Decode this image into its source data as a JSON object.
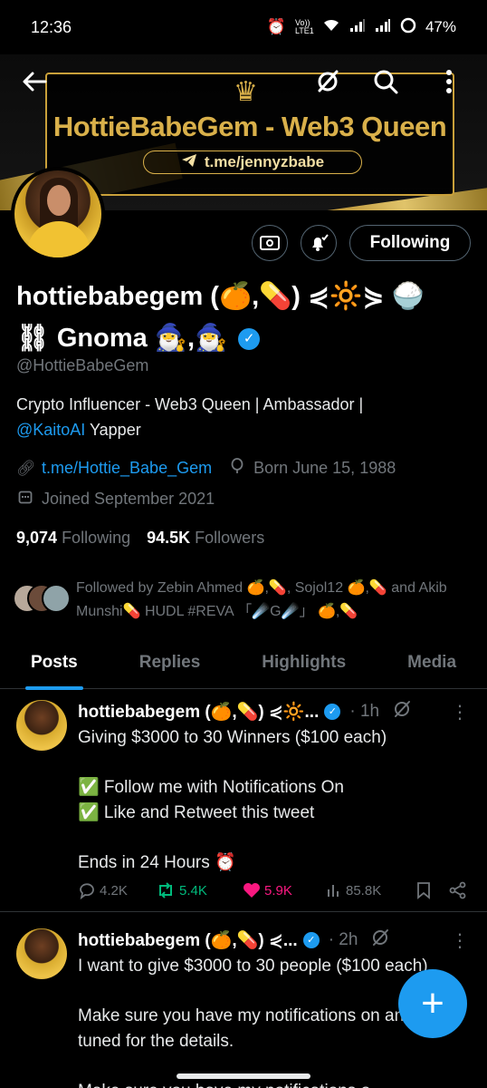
{
  "status_bar": {
    "time": "12:36",
    "network": "Vo)) LTE1",
    "battery": "47%"
  },
  "banner": {
    "title": "HottieBabeGem - Web3 Queen",
    "telegram": "t.me/jennyzbabe"
  },
  "header": {
    "back_icon": "arrow-left",
    "grok_icon": "slashed-circle",
    "search_icon": "search",
    "more_icon": "more-vertical"
  },
  "actions": {
    "following_label": "Following"
  },
  "profile": {
    "name_line1": "hottiebabegem (🍊,💊) ⋞🔆⋟ 🍚",
    "name_line2": "⛓ Gnoma 🧙‍♂️,🧙‍♂️",
    "handle": "@HottieBabeGem",
    "bio_text": "Crypto Influencer - Web3 Queen | Ambassador |",
    "bio_mention": "@KaitoAI",
    "bio_suffix": " Yapper",
    "link": "t.me/Hottie_Babe_Gem",
    "born": "Born June 15, 1988",
    "joined": "Joined September 2021",
    "following_count": "9,074",
    "following_label": "Following",
    "followers_count": "94.5K",
    "followers_label": "Followers",
    "followed_by": "Followed by Zebin Ahmed 🍊,💊, Sojol12 🍊,💊 and Akib Munshi💊 HUDL #REVA 「☄️G☄️」 🍊,💊"
  },
  "tabs": [
    "Posts",
    "Replies",
    "Highlights",
    "Media"
  ],
  "tweets": [
    {
      "name": "hottiebabegem (🍊,💊) ⋞🔆...",
      "time": "· 1h",
      "text": "Giving $3000 to 30 Winners ($100 each)\n\n✅ Follow me with Notifications On\n✅ Like and Retweet this tweet\n\nEnds in 24 Hours ⏰",
      "replies": "4.2K",
      "retweets": "5.4K",
      "likes": "5.9K",
      "views": "85.8K"
    },
    {
      "name": "hottiebabegem (🍊,💊) ⋞...",
      "time": "· 2h",
      "text": "I want to give $3000 to 30 people ($100 each)\n\nMake sure you have my notifications on and stay tuned for the details.\n\nMake sure you have my notifications o"
    }
  ],
  "colors": {
    "accent": "#1d9bf0",
    "gold": "#d9b04a",
    "retweet": "#00ba7c",
    "like": "#f91880"
  }
}
